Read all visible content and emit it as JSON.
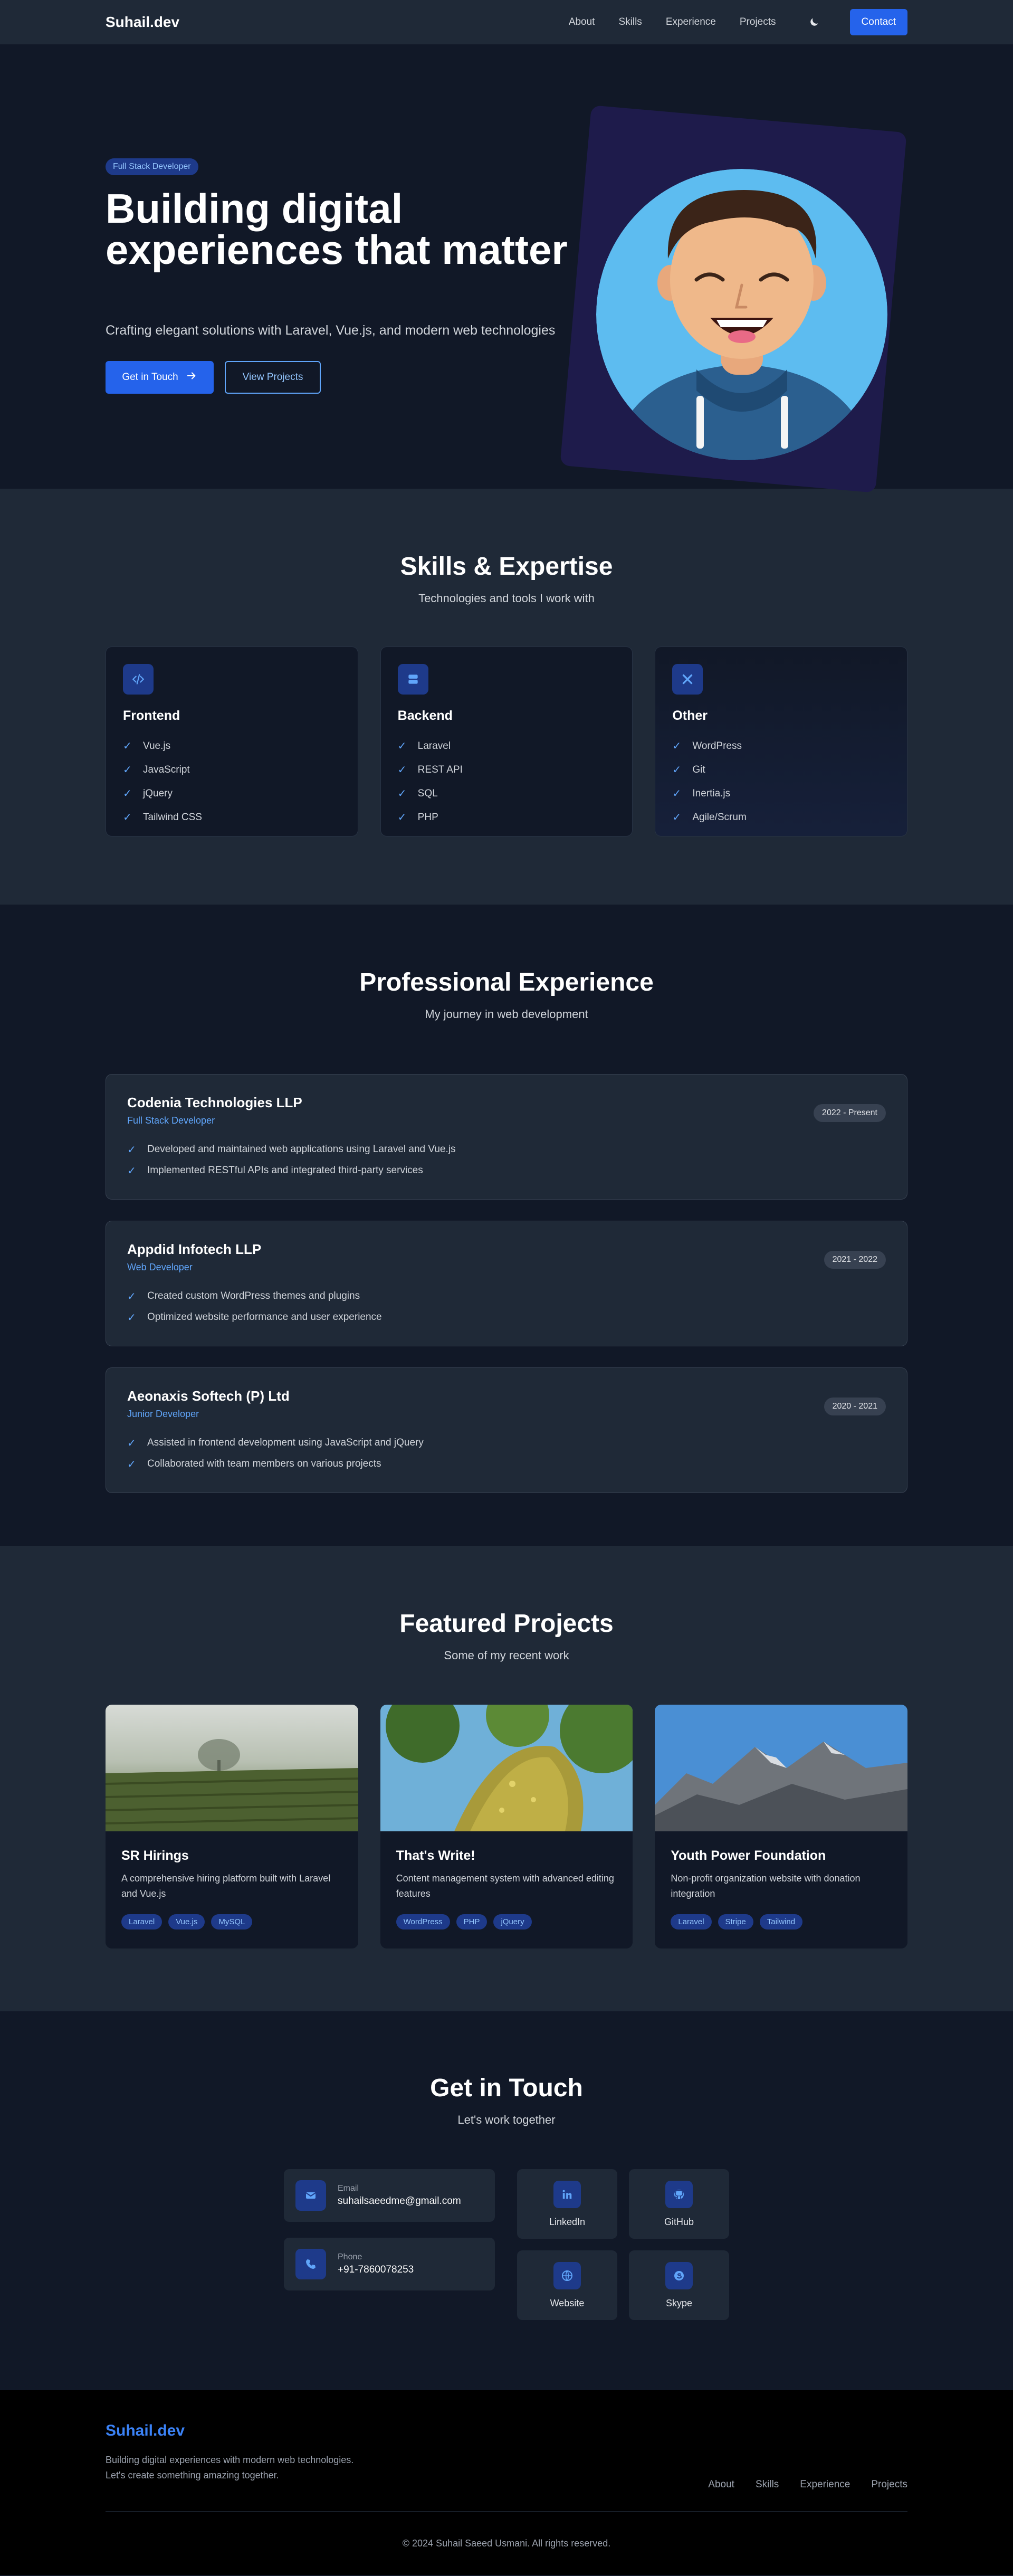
{
  "nav": {
    "brand": "Suhail.dev",
    "links": [
      "About",
      "Skills",
      "Experience",
      "Projects"
    ],
    "theme_icon": "moon-icon",
    "cta": "Contact",
    "accent": "#2563eb"
  },
  "hero": {
    "badge": "Full Stack Developer",
    "title": "Building digital experiences that matter",
    "subtitle": "Crafting elegant solutions with Laravel, Vue.js, and modern web technologies",
    "primary_button": "Get in Touch",
    "primary_icon": "arrow-right-icon",
    "secondary_button": "View Projects"
  },
  "skills": {
    "title": "Skills & Expertise",
    "subtitle": "Technologies and tools I work with",
    "cards": [
      {
        "title": "Frontend",
        "icon": "code-icon",
        "items": [
          "Vue.js",
          "JavaScript",
          "jQuery",
          "Tailwind CSS"
        ]
      },
      {
        "title": "Backend",
        "icon": "server-icon",
        "items": [
          "Laravel",
          "REST API",
          "SQL",
          "PHP"
        ]
      },
      {
        "title": "Other",
        "icon": "tools-icon",
        "items": [
          "WordPress",
          "Git",
          "Inertia.js",
          "Agile/Scrum"
        ]
      }
    ]
  },
  "experience": {
    "title": "Professional Experience",
    "subtitle": "My journey in web development",
    "jobs": [
      {
        "company": "Codenia Technologies LLP",
        "role": "Full Stack Developer",
        "period": "2022 - Present",
        "points": [
          "Developed and maintained web applications using Laravel and Vue.js",
          "Implemented RESTful APIs and integrated third-party services"
        ]
      },
      {
        "company": "Appdid Infotech LLP",
        "role": "Web Developer",
        "period": "2021 - 2022",
        "points": [
          "Created custom WordPress themes and plugins",
          "Optimized website performance and user experience"
        ]
      },
      {
        "company": "Aeonaxis Softech (P) Ltd",
        "role": "Junior Developer",
        "period": "2020 - 2021",
        "points": [
          "Assisted in frontend development using JavaScript and jQuery",
          "Collaborated with team members on various projects"
        ]
      }
    ]
  },
  "projects": {
    "title": "Featured Projects",
    "subtitle": "Some of my recent work",
    "items": [
      {
        "title": "SR Hirings",
        "desc": "A comprehensive hiring platform built with Laravel and Vue.js",
        "tags": [
          "Laravel",
          "Vue.js",
          "MySQL"
        ]
      },
      {
        "title": "That's Write!",
        "desc": "Content management system with advanced editing features",
        "tags": [
          "WordPress",
          "PHP",
          "jQuery"
        ]
      },
      {
        "title": "Youth Power Foundation",
        "desc": "Non-profit organization website with donation integration",
        "tags": [
          "Laravel",
          "Stripe",
          "Tailwind"
        ]
      }
    ]
  },
  "contact": {
    "title": "Get in Touch",
    "subtitle": "Let's work together",
    "email_label": "Email",
    "email": "suhailsaeedme@gmail.com",
    "phone_label": "Phone",
    "phone": "+91-7860078253",
    "socials": [
      {
        "label": "LinkedIn",
        "icon": "linkedin-icon"
      },
      {
        "label": "GitHub",
        "icon": "github-icon"
      },
      {
        "label": "Website",
        "icon": "globe-icon"
      },
      {
        "label": "Skype",
        "icon": "skype-icon"
      }
    ]
  },
  "footer": {
    "brand": "Suhail.dev",
    "tagline_1": "Building digital experiences with modern web technologies.",
    "tagline_2": "Let's create something amazing together.",
    "links": [
      "About",
      "Skills",
      "Experience",
      "Projects"
    ],
    "copyright": "© 2024 Suhail Saeed Usmani. All rights reserved."
  }
}
